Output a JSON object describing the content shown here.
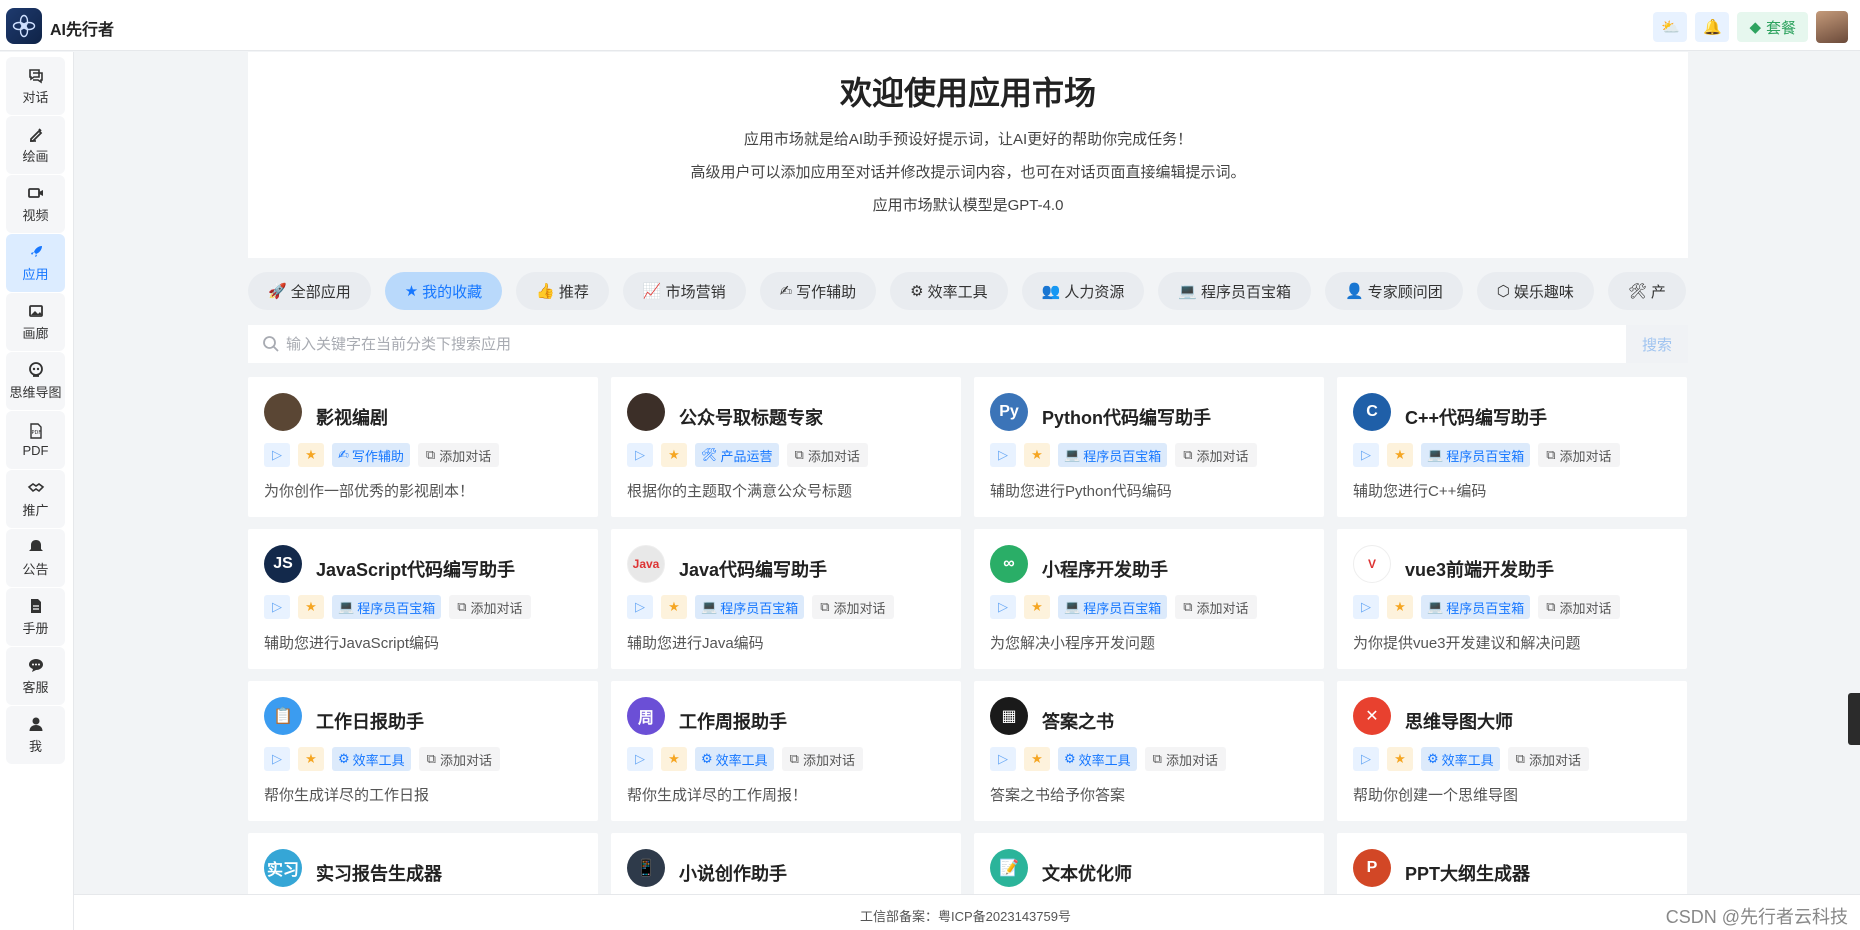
{
  "app": {
    "title": "AI先行者"
  },
  "topbar": {
    "plan_label": "套餐"
  },
  "sidebar": [
    {
      "label": "对话",
      "icon": "chat-icon"
    },
    {
      "label": "绘画",
      "icon": "brush-icon"
    },
    {
      "label": "视频",
      "icon": "video-icon"
    },
    {
      "label": "应用",
      "icon": "rocket-icon"
    },
    {
      "label": "画廊",
      "icon": "gallery-icon"
    },
    {
      "label": "思维导图",
      "icon": "mindmap-icon"
    },
    {
      "label": "PDF",
      "icon": "pdf-icon"
    },
    {
      "label": "推广",
      "icon": "handshake-icon"
    },
    {
      "label": "公告",
      "icon": "bell-icon"
    },
    {
      "label": "手册",
      "icon": "file-icon"
    },
    {
      "label": "客服",
      "icon": "support-icon"
    },
    {
      "label": "我",
      "icon": "user-icon"
    }
  ],
  "hero": {
    "title": "欢迎使用应用市场",
    "line1": "应用市场就是给AI助手预设好提示词，让AI更好的帮助你完成任务！",
    "line2": "高级用户可以添加应用至对话并修改提示词内容，也可在对话页面直接编辑提示词。",
    "line3": "应用市场默认模型是GPT-4.0"
  },
  "categories": [
    {
      "label": "全部应用",
      "icon": "🚀"
    },
    {
      "label": "我的收藏",
      "icon": "★"
    },
    {
      "label": "推荐",
      "icon": "👍"
    },
    {
      "label": "市场营销",
      "icon": "📈"
    },
    {
      "label": "写作辅助",
      "icon": "✍"
    },
    {
      "label": "效率工具",
      "icon": "⚙"
    },
    {
      "label": "人力资源",
      "icon": "👥"
    },
    {
      "label": "程序员百宝箱",
      "icon": "💻"
    },
    {
      "label": "专家顾问团",
      "icon": "👤"
    },
    {
      "label": "娱乐趣味",
      "icon": "⬡"
    },
    {
      "label": "产",
      "icon": "🛠"
    }
  ],
  "search": {
    "placeholder": "输入关键字在当前分类下搜索应用",
    "button": "搜索"
  },
  "add_label": "添加对话",
  "cards": [
    {
      "title": "影视编剧",
      "tag": "写作辅助",
      "tag_icon": "✍",
      "desc": "为你创作一部优秀的影视剧本！",
      "icon_color": "#5a4634",
      "icon_text": ""
    },
    {
      "title": "公众号取标题专家",
      "tag": "产品运营",
      "tag_icon": "🛠",
      "desc": "根据你的主题取个满意公众号标题",
      "icon_color": "#3c2f28",
      "icon_text": ""
    },
    {
      "title": "Python代码编写助手",
      "tag": "程序员百宝箱",
      "tag_icon": "💻",
      "desc": "辅助您进行Python代码编码",
      "icon_color": "#3b74b8",
      "icon_text": "Py"
    },
    {
      "title": "C++代码编写助手",
      "tag": "程序员百宝箱",
      "tag_icon": "💻",
      "desc": "辅助您进行C++编码",
      "icon_color": "#1f5fa8",
      "icon_text": "C"
    },
    {
      "title": "JavaScript代码编写助手",
      "tag": "程序员百宝箱",
      "tag_icon": "💻",
      "desc": "辅助您进行JavaScript编码",
      "icon_color": "#13294b",
      "icon_text": "JS"
    },
    {
      "title": "Java代码编写助手",
      "tag": "程序员百宝箱",
      "tag_icon": "💻",
      "desc": "辅助您进行Java编码",
      "icon_color": "#e8e8e8",
      "icon_text": "Java"
    },
    {
      "title": "小程序开发助手",
      "tag": "程序员百宝箱",
      "tag_icon": "💻",
      "desc": "为您解决小程序开发问题",
      "icon_color": "#2aae67",
      "icon_text": "∞"
    },
    {
      "title": "vue3前端开发助手",
      "tag": "程序员百宝箱",
      "tag_icon": "💻",
      "desc": "为你提供vue3开发建议和解决问题",
      "icon_color": "#ffffff",
      "icon_text": "V"
    },
    {
      "title": "工作日报助手",
      "tag": "效率工具",
      "tag_icon": "⚙",
      "desc": "帮你生成详尽的工作日报",
      "icon_color": "#3b9cf0",
      "icon_text": "📋"
    },
    {
      "title": "工作周报助手",
      "tag": "效率工具",
      "tag_icon": "⚙",
      "desc": "帮你生成详尽的工作周报！",
      "icon_color": "#6b4fd6",
      "icon_text": "周"
    },
    {
      "title": "答案之书",
      "tag": "效率工具",
      "tag_icon": "⚙",
      "desc": "答案之书给予你答案",
      "icon_color": "#1a1a1a",
      "icon_text": "▦"
    },
    {
      "title": "思维导图大师",
      "tag": "效率工具",
      "tag_icon": "⚙",
      "desc": "帮助你创建一个思维导图",
      "icon_color": "#e8412f",
      "icon_text": "✕"
    },
    {
      "title": "实习报告生成器",
      "tag": "",
      "tag_icon": "",
      "desc": "",
      "icon_color": "#35a6d6",
      "icon_text": "实习"
    },
    {
      "title": "小说创作助手",
      "tag": "",
      "tag_icon": "",
      "desc": "",
      "icon_color": "#2e3a4a",
      "icon_text": "📱"
    },
    {
      "title": "文本优化师",
      "tag": "",
      "tag_icon": "",
      "desc": "",
      "icon_color": "#2bb49a",
      "icon_text": "📝"
    },
    {
      "title": "PPT大纲生成器",
      "tag": "",
      "tag_icon": "",
      "desc": "",
      "icon_color": "#d24726",
      "icon_text": "P"
    }
  ],
  "footer": {
    "icp": "工信部备案：粤ICP备2023143759号",
    "watermark": "CSDN @先行者云科技"
  },
  "colors": {
    "accent": "#1677ff",
    "active_bg": "#dcecff",
    "green": "#2ea35f"
  }
}
